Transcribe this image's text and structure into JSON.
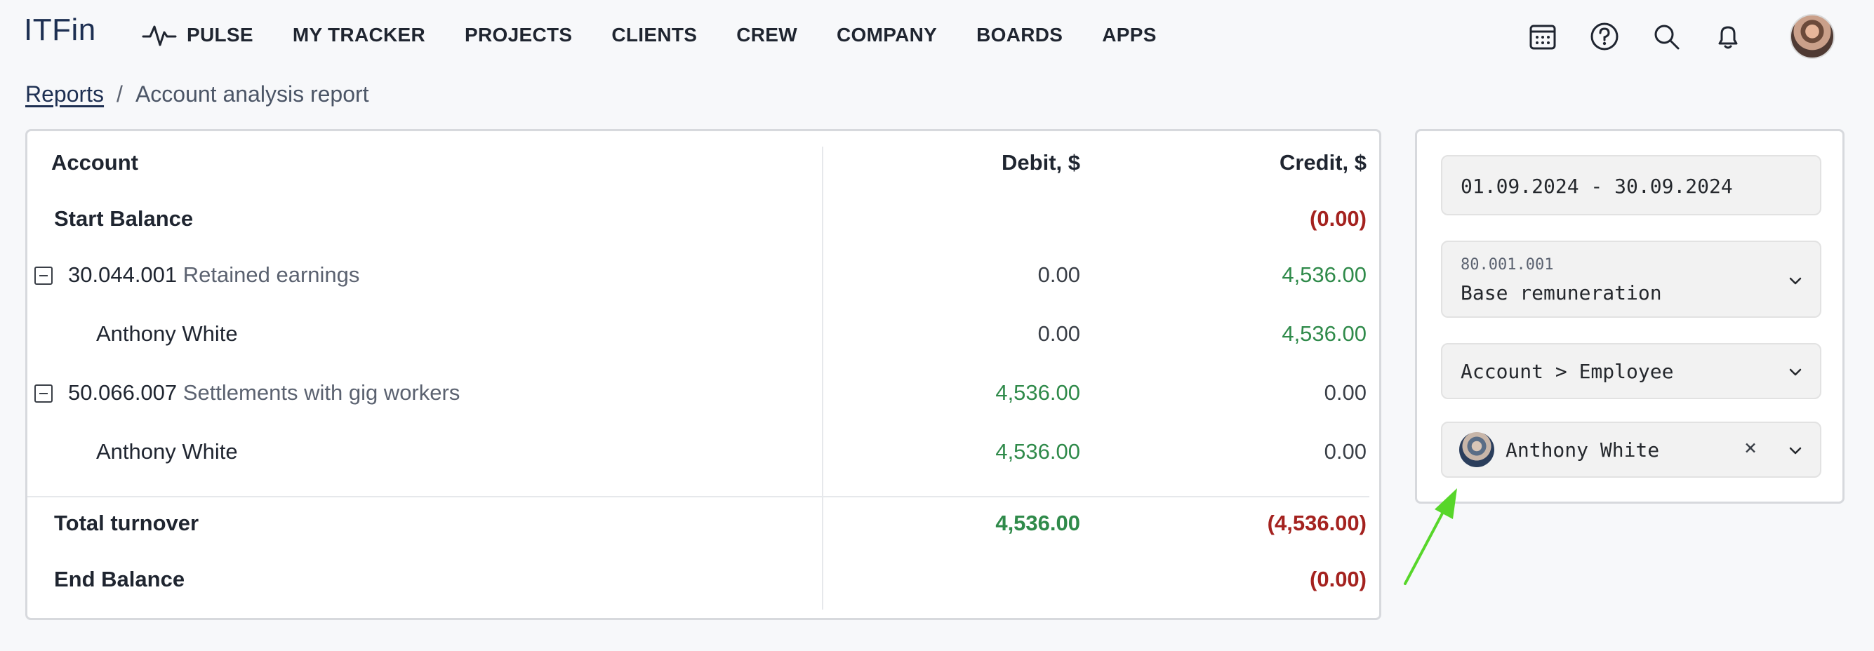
{
  "app": {
    "logo": "ITFin"
  },
  "nav": {
    "items": [
      {
        "label": "PULSE",
        "icon": "pulse-icon"
      },
      {
        "label": "MY TRACKER"
      },
      {
        "label": "PROJECTS"
      },
      {
        "label": "CLIENTS"
      },
      {
        "label": "CREW"
      },
      {
        "label": "COMPANY"
      },
      {
        "label": "BOARDS"
      },
      {
        "label": "APPS"
      }
    ]
  },
  "top_icons": [
    "calendar-icon",
    "help-icon",
    "search-icon",
    "bell-icon",
    "user-avatar"
  ],
  "breadcrumb": {
    "parent": "Reports",
    "separator": "/",
    "current": "Account analysis report"
  },
  "table": {
    "headers": {
      "account": "Account",
      "debit": "Debit, $",
      "credit": "Credit, $"
    },
    "start_balance": {
      "label": "Start Balance",
      "debit": "",
      "credit": "(0.00)"
    },
    "groups": [
      {
        "code": "30.044.001",
        "name": "Retained earnings",
        "debit": "0.00",
        "credit": "4,536.00",
        "children": [
          {
            "name": "Anthony White",
            "debit": "0.00",
            "credit": "4,536.00"
          }
        ]
      },
      {
        "code": "50.066.007",
        "name": "Settlements with gig workers",
        "debit": "4,536.00",
        "credit": "0.00",
        "children": [
          {
            "name": "Anthony White",
            "debit": "4,536.00",
            "credit": "0.00"
          }
        ]
      }
    ],
    "total_turnover": {
      "label": "Total turnover",
      "debit": "4,536.00",
      "credit": "(4,536.00)"
    },
    "end_balance": {
      "label": "End Balance",
      "debit": "",
      "credit": "(0.00)"
    }
  },
  "filters": {
    "date_range": "01.09.2024 - 30.09.2024",
    "account": {
      "code": "80.001.001",
      "name": "Base remuneration"
    },
    "grouping": "Account > Employee",
    "employee": "Anthony White"
  },
  "colors": {
    "positive": "#2f8a4a",
    "negative": "#a4221f",
    "brand": "#1d2f52",
    "annotation_arrow": "#57d62a"
  }
}
